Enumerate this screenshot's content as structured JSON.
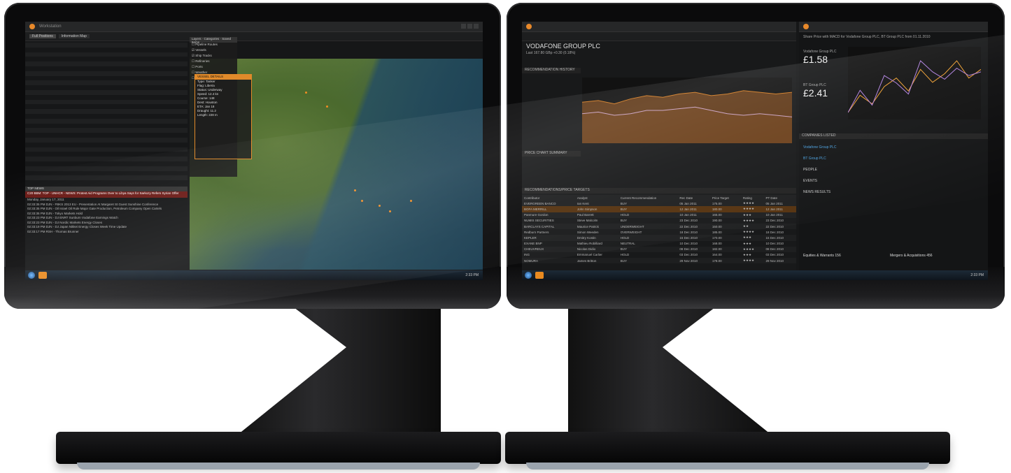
{
  "left_screen": {
    "window_title": "Workstation",
    "panel_title": "Full Positions",
    "map_panel_title": "Information Map",
    "map_tabs": [
      "Layers",
      "Categories",
      "Saved Items"
    ],
    "news_header": "TOP NEWS",
    "news_highlight": "C20 BBM: TOP - UNHCR - NEWS: Protest Aid Programs Over to Libya Says for Sarkozy Refers Syrian Offer",
    "news_date": "Monday, January 17, 2011",
    "news_items": [
      "02:33:35 PM  DJN - FBKS 2013 EU - Presentation At Margaret St Guest Sunshine Conference",
      "02:33:35 PM  DJN - Oil Israel Oil Rule Major Gate Production, Petroleum Company Open Cartels",
      "02:33:35 PM  DJN - Tokyo Markets Hold",
      "02:33:23 PM  DJN - DJ ENRT Sunburn Vodafone Earnings Watch",
      "02:33:23 PM  DJN - DJ Nordic Markets Energy Closes",
      "02:33:19 PM  DJN - DJ Japan Nikkei Energy Closes Week Time Update",
      "02:33:17 PM  RSH - Thomas Brunner"
    ],
    "popup": {
      "title": "VESSEL DETAILS",
      "rows": [
        "Type: Tanker",
        "Flag: Liberia",
        "Status: Underway",
        "Speed: 12.4 kn",
        "Course: 148",
        "Dest: Houston",
        "ETA: Jan 18",
        "Draught: 11.2",
        "Length: 228 m"
      ]
    },
    "layers": [
      "Pipeline Routes",
      "Vessels",
      "Ship Tracks",
      "Refineries",
      "Ports",
      "Weather",
      "Storage"
    ],
    "taskbar_clock": "2:33 PM"
  },
  "right_screen": {
    "company_title": "VODAFONE GROUP PLC",
    "price_line": "Last 167.80 GBp  +0.30 (0.18%)",
    "chart_header": "RECOMMENDATION HISTORY",
    "consensus_header": "PRICE CHART SUMMARY",
    "table_header": "RECOMMENDATIONS/PRICE TARGETS",
    "table_columns": [
      "Contributor",
      "Analyst",
      "Current Recommendation",
      "Rec Date",
      "Price Target",
      "Rating",
      "PT Date"
    ],
    "table_rows": [
      [
        "EVERGREEN BANCO",
        "Ian Kent",
        "BUY",
        "05 Jan 2011",
        "175.00",
        "★★★★",
        "05 Jan 2011"
      ],
      [
        "BOFA MERRILL",
        "John Simpson",
        "BUY",
        "12 Jan 2011",
        "180.00",
        "★★★★",
        "12 Jan 2011"
      ],
      [
        "Panmure Gordon",
        "Paul Barrett",
        "HOLD",
        "10 Jan 2011",
        "165.00",
        "★★★",
        "10 Jan 2011"
      ],
      [
        "NUMIS SECURITIES",
        "Steve Malcolm",
        "BUY",
        "23 Dec 2010",
        "190.00",
        "★★★★",
        "23 Dec 2010"
      ],
      [
        "BARCLAYS CAPITAL",
        "Maurice Patrick",
        "UNDERWEIGHT",
        "22 Dec 2010",
        "150.00",
        "★★",
        "22 Dec 2010"
      ],
      [
        "Redburn Partners",
        "Simon Weeden",
        "OVERWEIGHT",
        "18 Dec 2010",
        "185.00",
        "★★★★",
        "18 Dec 2010"
      ],
      [
        "KEPLER",
        "Dmitry Kostin",
        "HOLD",
        "15 Dec 2010",
        "170.00",
        "★★★",
        "15 Dec 2010"
      ],
      [
        "EXANE BNP",
        "Mathieu Robilliard",
        "NEUTRAL",
        "10 Dec 2010",
        "168.00",
        "★★★",
        "10 Dec 2010"
      ],
      [
        "CHEUVREUX",
        "Nicolas Didio",
        "BUY",
        "08 Dec 2010",
        "182.00",
        "★★★★",
        "08 Dec 2010"
      ],
      [
        "ING",
        "Emmanuel Carlier",
        "HOLD",
        "03 Dec 2010",
        "164.00",
        "★★★",
        "03 Dec 2010"
      ],
      [
        "NOMURA",
        "James Britton",
        "BUY",
        "29 Nov 2010",
        "178.00",
        "★★★★",
        "29 Nov 2010"
      ]
    ],
    "right_pane": {
      "title": "Share Price with MACD for Vodafone Group PLC, BT Group PLC from 01.11.2010",
      "company1": "Vodafone Group PLC",
      "price1": "£1.58",
      "company2": "BT Group PLC",
      "price2": "£2.41",
      "related_title": "COMPANIES LISTED",
      "items": [
        "Vodafone Group PLC",
        "BT Group PLC",
        "PEOPLE",
        "EVENTS",
        "NEWS RESULTS"
      ],
      "footer_left": "Equities & Warrants 156",
      "footer_right": "Mergers & Acquisitions 456"
    },
    "taskbar_clock": "2:33 PM"
  },
  "chart_data": [
    {
      "type": "area",
      "title": "",
      "series": [
        {
          "name": "",
          "values": [
            165,
            166,
            164,
            167,
            169,
            168,
            170,
            171,
            169,
            170,
            172,
            171,
            170,
            171
          ]
        },
        {
          "name": "",
          "values": [
            158,
            159,
            157,
            158,
            160,
            160,
            161,
            162,
            160,
            158,
            157,
            158,
            157,
            156
          ]
        }
      ],
      "ylim": [
        140,
        180
      ]
    },
    {
      "type": "line",
      "title": "",
      "series": [
        {
          "name": "Vodafone Group PLC",
          "values": [
            150,
            154,
            152,
            156,
            158,
            155,
            160,
            157,
            159,
            162,
            158,
            160
          ]
        },
        {
          "name": "BT Group PLC",
          "values": [
            230,
            236,
            232,
            240,
            238,
            235,
            244,
            241,
            239,
            242,
            240,
            241
          ]
        }
      ]
    }
  ]
}
